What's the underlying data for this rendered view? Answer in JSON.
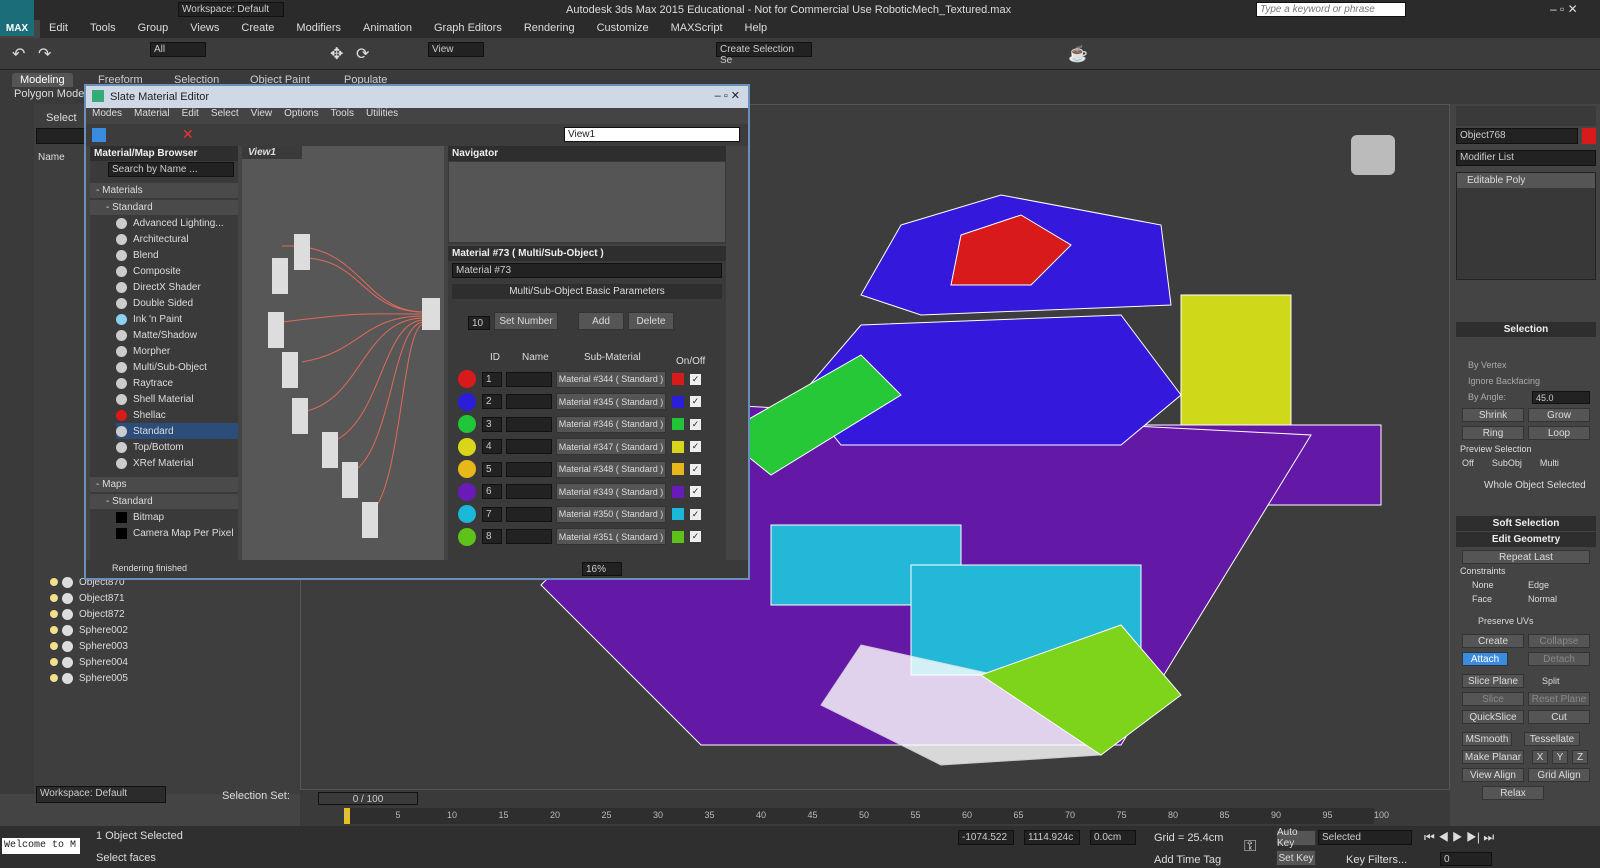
{
  "window": {
    "title": "Autodesk 3ds Max  2015  Educational - Not for Commercial Use    RoboticMech_Textured.max",
    "workspace": "Workspace: Default",
    "search_placeholder": "Type a keyword or phrase"
  },
  "menu": [
    "Edit",
    "Tools",
    "Group",
    "Views",
    "Create",
    "Modifiers",
    "Animation",
    "Graph Editors",
    "Rendering",
    "Customize",
    "MAXScript",
    "Help"
  ],
  "toolbar": {
    "filter": "All",
    "view": "View",
    "selection_set": "Create Selection Se"
  },
  "ribbon": {
    "tabs": [
      "Modeling",
      "Freeform",
      "Selection",
      "Object Paint",
      "Populate"
    ],
    "sub": "Polygon Modeli"
  },
  "scene": {
    "select_label": "Select",
    "name_col": "Name",
    "objects": [
      "Object870",
      "Object871",
      "Object872",
      "Sphere002",
      "Sphere003",
      "Sphere004",
      "Sphere005"
    ],
    "workspace": "Workspace: Default",
    "selection_set": "Selection Set:"
  },
  "slate": {
    "title": "Slate Material Editor",
    "menu": [
      "Modes",
      "Material",
      "Edit",
      "Select",
      "View",
      "Options",
      "Tools",
      "Utilities"
    ],
    "view_dropdown": "View1",
    "browser_title": "Material/Map Browser",
    "search_placeholder": "Search by Name ...",
    "materials_group": "- Materials",
    "standard_group": "- Standard",
    "materials": [
      "Advanced Lighting...",
      "Architectural",
      "Blend",
      "Composite",
      "DirectX Shader",
      "Double Sided",
      "Ink 'n Paint",
      "Matte/Shadow",
      "Morpher",
      "Multi/Sub-Object",
      "Raytrace",
      "Shell Material",
      "Shellac",
      "Standard",
      "Top/Bottom",
      "XRef Material"
    ],
    "maps_group": "- Maps",
    "maps_standard": "- Standard",
    "maps": [
      "Bitmap",
      "Camera Map Per Pixel"
    ],
    "view_tab": "View1",
    "navigator": "Navigator",
    "param_title": "Material #73  ( Multi/Sub-Object )",
    "param_name": "Material #73",
    "rollout": "Multi/Sub-Object Basic Parameters",
    "count": "10",
    "set_number": "Set Number",
    "add": "Add",
    "delete": "Delete",
    "cols": {
      "id": "ID",
      "name": "Name",
      "sub": "Sub-Material",
      "onoff": "On/Off"
    },
    "rows": [
      {
        "id": "1",
        "sub": "Material #344  ( Standard )",
        "color": "#d81a1a"
      },
      {
        "id": "2",
        "sub": "Material #345  ( Standard )",
        "color": "#2a1ed8"
      },
      {
        "id": "3",
        "sub": "Material #346  ( Standard )",
        "color": "#21c638"
      },
      {
        "id": "4",
        "sub": "Material #347  ( Standard )",
        "color": "#d9d51a"
      },
      {
        "id": "5",
        "sub": "Material #348  ( Standard )",
        "color": "#e8b81a"
      },
      {
        "id": "6",
        "sub": "Material #349  ( Standard )",
        "color": "#6a1ab8"
      },
      {
        "id": "7",
        "sub": "Material #350  ( Standard )",
        "color": "#1ab8d9"
      },
      {
        "id": "8",
        "sub": "Material #351  ( Standard )",
        "color": "#5ec21a"
      }
    ],
    "status": "Rendering finished",
    "zoom": "16%"
  },
  "cmd": {
    "object_name": "Object768",
    "modifier_list": "Modifier List",
    "stack_item": "Editable Poly",
    "selection": "Selection",
    "by_vertex": "By Vertex",
    "ignore_backfacing": "Ignore Backfacing",
    "by_angle": "By Angle:",
    "angle": "45.0",
    "shrink": "Shrink",
    "grow": "Grow",
    "ring": "Ring",
    "loop": "Loop",
    "preview_selection": "Preview Selection",
    "preview_opts": [
      "Off",
      "SubObj",
      "Multi"
    ],
    "whole_object": "Whole Object Selected",
    "soft_selection": "Soft Selection",
    "edit_geometry": "Edit Geometry",
    "repeat_last": "Repeat Last",
    "constraints": "Constraints",
    "constraint_opts": [
      "None",
      "Edge",
      "Face",
      "Normal"
    ],
    "preserve_uvs": "Preserve UVs",
    "create": "Create",
    "collapse": "Collapse",
    "attach": "Attach",
    "detach": "Detach",
    "slice_plane": "Slice Plane",
    "split": "Split",
    "slice": "Slice",
    "reset_plane": "Reset Plane",
    "quickslice": "QuickSlice",
    "cut": "Cut",
    "msmooth": "MSmooth",
    "tessellate": "Tessellate",
    "make_planar": "Make Planar",
    "x": "X",
    "y": "Y",
    "z": "Z",
    "view_align": "View Align",
    "grid_align": "Grid Align",
    "relax": "Relax"
  },
  "timeline": {
    "frame": "0 / 100",
    "ticks": [
      "0",
      "5",
      "10",
      "15",
      "20",
      "25",
      "30",
      "35",
      "40",
      "45",
      "50",
      "55",
      "60",
      "65",
      "70",
      "75",
      "80",
      "85",
      "90",
      "95",
      "100"
    ]
  },
  "status": {
    "welcome": "Welcome to M",
    "selected": "1 Object Selected",
    "prompt": "Select faces",
    "x": "-1074.522",
    "y": "1114.924c",
    "z": "0.0cm",
    "grid": "Grid = 25.4cm",
    "add_time_tag": "Add Time Tag",
    "auto_key": "Auto Key",
    "set_key": "Set Key",
    "selected_dd": "Selected",
    "key_filters": "Key Filters...",
    "frame": "0"
  }
}
